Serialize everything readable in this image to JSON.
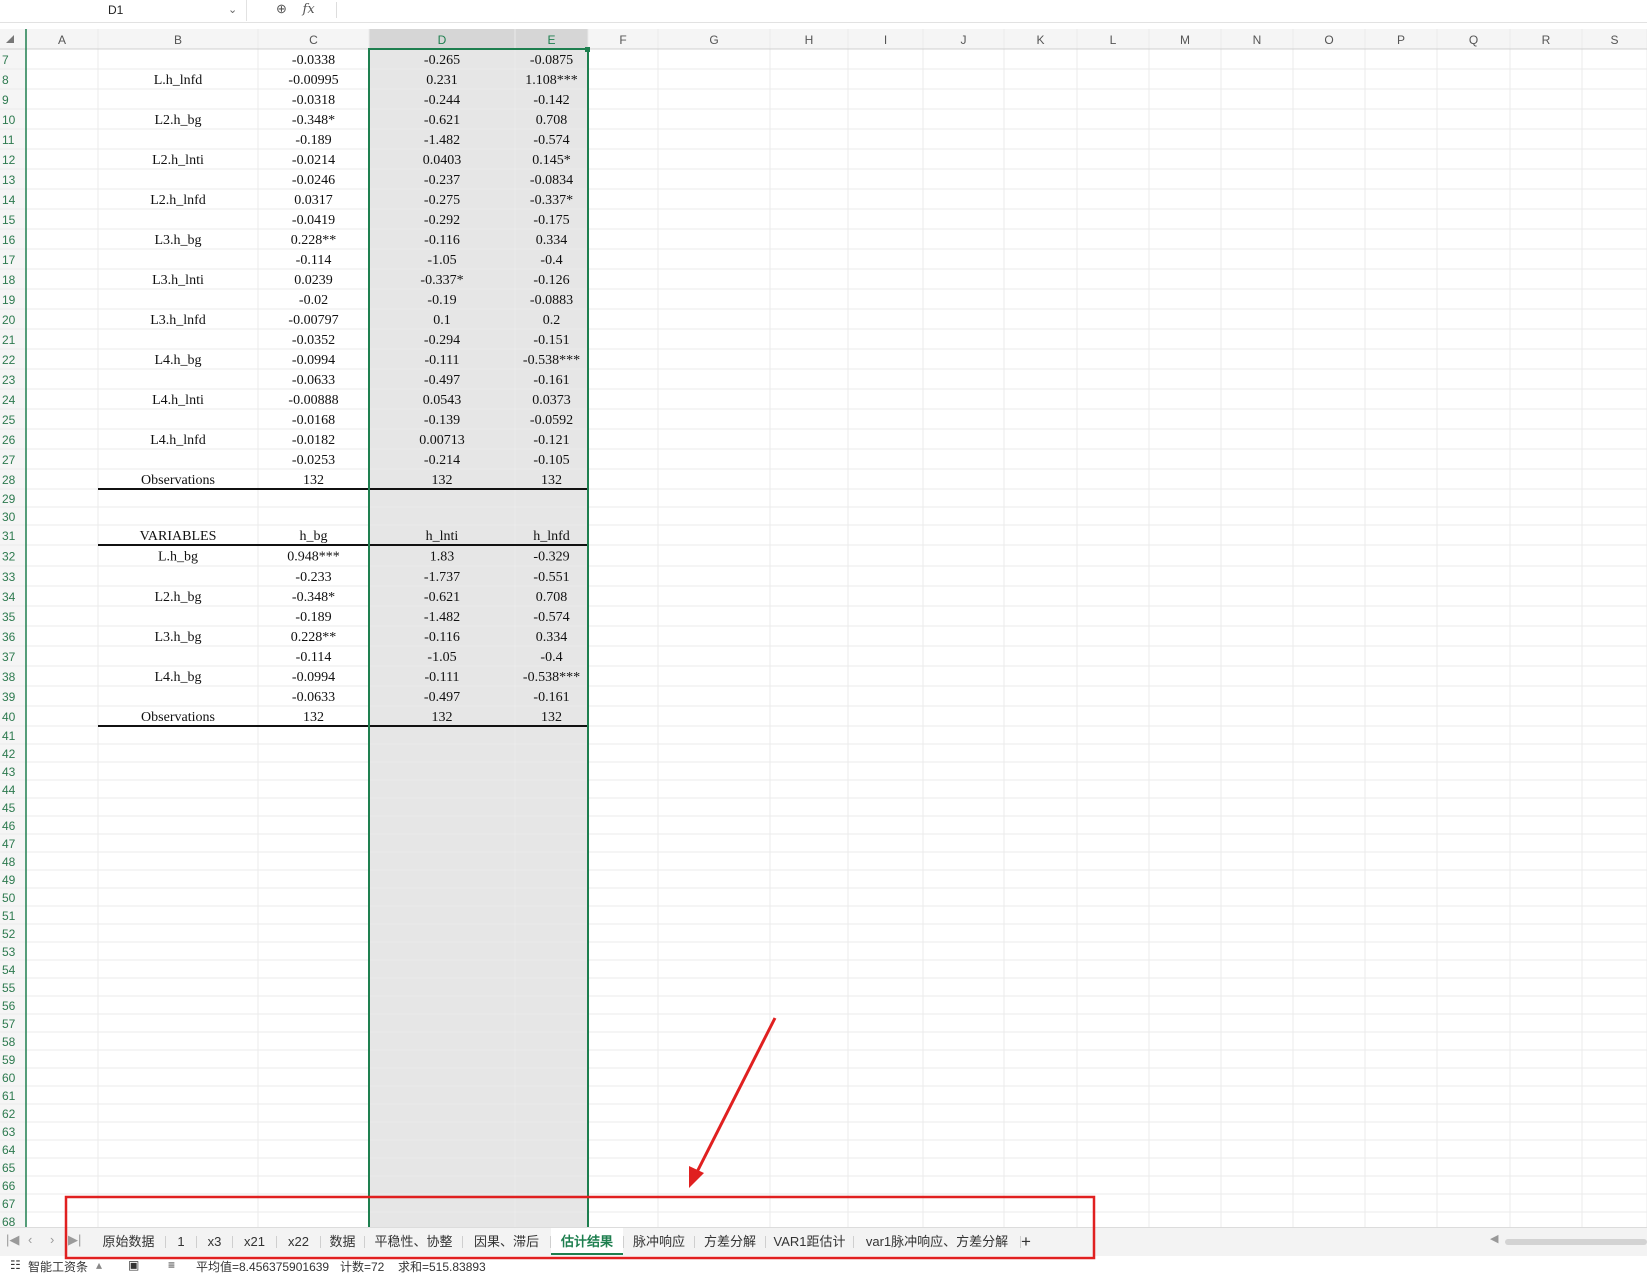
{
  "name_box": {
    "value": "D1",
    "dropdown_icon": "chevron-down-icon"
  },
  "formula": {
    "zoom_icon": "magnifier-icon",
    "fx_label": "fx",
    "value": ""
  },
  "columns": [
    "A",
    "B",
    "C",
    "D",
    "E",
    "F",
    "G",
    "H",
    "I",
    "J",
    "K",
    "L",
    "M",
    "N",
    "O",
    "P",
    "Q",
    "R",
    "S"
  ],
  "rows": [
    {
      "n": "7",
      "b": "",
      "c": "-0.0338",
      "d": "-0.265",
      "e": "-0.0875"
    },
    {
      "n": "8",
      "b": "L.h_lnfd",
      "c": "-0.00995",
      "d": "0.231",
      "e": "1.108***"
    },
    {
      "n": "9",
      "b": "",
      "c": "-0.0318",
      "d": "-0.244",
      "e": "-0.142"
    },
    {
      "n": "10",
      "b": "L2.h_bg",
      "c": "-0.348*",
      "d": "-0.621",
      "e": "0.708"
    },
    {
      "n": "11",
      "b": "",
      "c": "-0.189",
      "d": "-1.482",
      "e": "-0.574"
    },
    {
      "n": "12",
      "b": "L2.h_lnti",
      "c": "-0.0214",
      "d": "0.0403",
      "e": "0.145*"
    },
    {
      "n": "13",
      "b": "",
      "c": "-0.0246",
      "d": "-0.237",
      "e": "-0.0834"
    },
    {
      "n": "14",
      "b": "L2.h_lnfd",
      "c": "0.0317",
      "d": "-0.275",
      "e": "-0.337*"
    },
    {
      "n": "15",
      "b": "",
      "c": "-0.0419",
      "d": "-0.292",
      "e": "-0.175"
    },
    {
      "n": "16",
      "b": "L3.h_bg",
      "c": "0.228**",
      "d": "-0.116",
      "e": "0.334"
    },
    {
      "n": "17",
      "b": "",
      "c": "-0.114",
      "d": "-1.05",
      "e": "-0.4"
    },
    {
      "n": "18",
      "b": "L3.h_lnti",
      "c": "0.0239",
      "d": "-0.337*",
      "e": "-0.126"
    },
    {
      "n": "19",
      "b": "",
      "c": "-0.02",
      "d": "-0.19",
      "e": "-0.0883"
    },
    {
      "n": "20",
      "b": "L3.h_lnfd",
      "c": "-0.00797",
      "d": "0.1",
      "e": "0.2"
    },
    {
      "n": "21",
      "b": "",
      "c": "-0.0352",
      "d": "-0.294",
      "e": "-0.151"
    },
    {
      "n": "22",
      "b": "L4.h_bg",
      "c": "-0.0994",
      "d": "-0.111",
      "e": "-0.538***"
    },
    {
      "n": "23",
      "b": "",
      "c": "-0.0633",
      "d": "-0.497",
      "e": "-0.161"
    },
    {
      "n": "24",
      "b": "L4.h_lnti",
      "c": "-0.00888",
      "d": "0.0543",
      "e": "0.0373"
    },
    {
      "n": "25",
      "b": "",
      "c": "-0.0168",
      "d": "-0.139",
      "e": "-0.0592"
    },
    {
      "n": "26",
      "b": "L4.h_lnfd",
      "c": "-0.0182",
      "d": "0.00713",
      "e": "-0.121"
    },
    {
      "n": "27",
      "b": "",
      "c": "-0.0253",
      "d": "-0.214",
      "e": "-0.105"
    },
    {
      "n": "28",
      "b": "Observations",
      "c": "132",
      "d": "132",
      "e": "132"
    },
    {
      "n": "29",
      "b": "",
      "c": "",
      "d": "",
      "e": ""
    },
    {
      "n": "30",
      "b": "",
      "c": "",
      "d": "",
      "e": ""
    },
    {
      "n": "31",
      "b": "VARIABLES",
      "c": "h_bg",
      "d": "h_lnti",
      "e": "h_lnfd"
    },
    {
      "n": "32",
      "b": "L.h_bg",
      "c": "0.948***",
      "d": "1.83",
      "e": "-0.329"
    },
    {
      "n": "33",
      "b": "",
      "c": "-0.233",
      "d": "-1.737",
      "e": "-0.551"
    },
    {
      "n": "34",
      "b": "L2.h_bg",
      "c": "-0.348*",
      "d": "-0.621",
      "e": "0.708"
    },
    {
      "n": "35",
      "b": "",
      "c": "-0.189",
      "d": "-1.482",
      "e": "-0.574"
    },
    {
      "n": "36",
      "b": "L3.h_bg",
      "c": "0.228**",
      "d": "-0.116",
      "e": "0.334"
    },
    {
      "n": "37",
      "b": "",
      "c": "-0.114",
      "d": "-1.05",
      "e": "-0.4"
    },
    {
      "n": "38",
      "b": "L4.h_bg",
      "c": "-0.0994",
      "d": "-0.111",
      "e": "-0.538***"
    },
    {
      "n": "39",
      "b": "",
      "c": "-0.0633",
      "d": "-0.497",
      "e": "-0.161"
    },
    {
      "n": "40",
      "b": "Observations",
      "c": "132",
      "d": "132",
      "e": "132"
    }
  ],
  "empty_rows": [
    "41",
    "42",
    "43",
    "44",
    "45",
    "46",
    "47",
    "48",
    "49",
    "50",
    "51",
    "52",
    "53",
    "54",
    "55",
    "56",
    "57",
    "58",
    "59",
    "60",
    "61",
    "62",
    "63",
    "64",
    "65",
    "66",
    "67",
    "68"
  ],
  "sheet_tabs": [
    "原始数据",
    "1",
    "x3",
    "x21",
    "x22",
    "数据",
    "平稳性、协整",
    "因果、滞后",
    "估计结果",
    "脉冲响应",
    "方差分解",
    "VAR1距估计",
    "var1脉冲响应、方差分解"
  ],
  "active_tab": "估计结果",
  "add_sheet_label": "+",
  "status": {
    "tool": "智能工资条",
    "average": "平均值=8.456375901639",
    "count": "计数=72",
    "sum": "求和=515.83893"
  },
  "colors": {
    "accent": "#1e7f4f",
    "selection_fill": "#e6e6e6",
    "annotation": "#e02020"
  }
}
